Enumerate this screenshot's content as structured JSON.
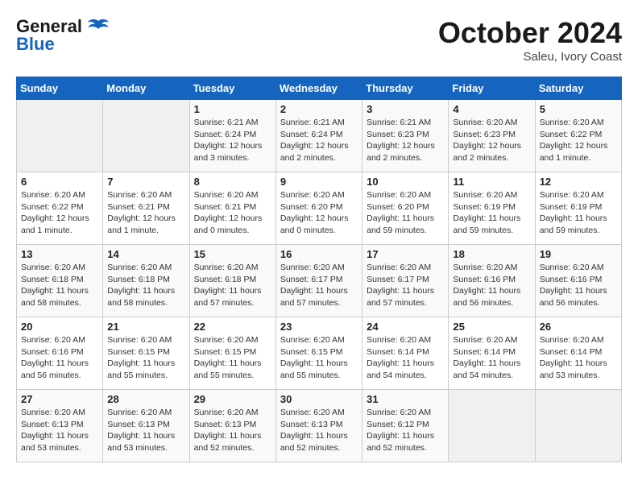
{
  "header": {
    "logo": {
      "general": "General",
      "blue": "Blue",
      "bird_unicode": "🐦"
    },
    "title": "October 2024",
    "subtitle": "Saleu, Ivory Coast"
  },
  "weekdays": [
    "Sunday",
    "Monday",
    "Tuesday",
    "Wednesday",
    "Thursday",
    "Friday",
    "Saturday"
  ],
  "weeks": [
    [
      {
        "day": "",
        "info": ""
      },
      {
        "day": "",
        "info": ""
      },
      {
        "day": "1",
        "info": "Sunrise: 6:21 AM\nSunset: 6:24 PM\nDaylight: 12 hours and 3 minutes."
      },
      {
        "day": "2",
        "info": "Sunrise: 6:21 AM\nSunset: 6:24 PM\nDaylight: 12 hours and 2 minutes."
      },
      {
        "day": "3",
        "info": "Sunrise: 6:21 AM\nSunset: 6:23 PM\nDaylight: 12 hours and 2 minutes."
      },
      {
        "day": "4",
        "info": "Sunrise: 6:20 AM\nSunset: 6:23 PM\nDaylight: 12 hours and 2 minutes."
      },
      {
        "day": "5",
        "info": "Sunrise: 6:20 AM\nSunset: 6:22 PM\nDaylight: 12 hours and 1 minute."
      }
    ],
    [
      {
        "day": "6",
        "info": "Sunrise: 6:20 AM\nSunset: 6:22 PM\nDaylight: 12 hours and 1 minute."
      },
      {
        "day": "7",
        "info": "Sunrise: 6:20 AM\nSunset: 6:21 PM\nDaylight: 12 hours and 1 minute."
      },
      {
        "day": "8",
        "info": "Sunrise: 6:20 AM\nSunset: 6:21 PM\nDaylight: 12 hours and 0 minutes."
      },
      {
        "day": "9",
        "info": "Sunrise: 6:20 AM\nSunset: 6:20 PM\nDaylight: 12 hours and 0 minutes."
      },
      {
        "day": "10",
        "info": "Sunrise: 6:20 AM\nSunset: 6:20 PM\nDaylight: 11 hours and 59 minutes."
      },
      {
        "day": "11",
        "info": "Sunrise: 6:20 AM\nSunset: 6:19 PM\nDaylight: 11 hours and 59 minutes."
      },
      {
        "day": "12",
        "info": "Sunrise: 6:20 AM\nSunset: 6:19 PM\nDaylight: 11 hours and 59 minutes."
      }
    ],
    [
      {
        "day": "13",
        "info": "Sunrise: 6:20 AM\nSunset: 6:18 PM\nDaylight: 11 hours and 58 minutes."
      },
      {
        "day": "14",
        "info": "Sunrise: 6:20 AM\nSunset: 6:18 PM\nDaylight: 11 hours and 58 minutes."
      },
      {
        "day": "15",
        "info": "Sunrise: 6:20 AM\nSunset: 6:18 PM\nDaylight: 11 hours and 57 minutes."
      },
      {
        "day": "16",
        "info": "Sunrise: 6:20 AM\nSunset: 6:17 PM\nDaylight: 11 hours and 57 minutes."
      },
      {
        "day": "17",
        "info": "Sunrise: 6:20 AM\nSunset: 6:17 PM\nDaylight: 11 hours and 57 minutes."
      },
      {
        "day": "18",
        "info": "Sunrise: 6:20 AM\nSunset: 6:16 PM\nDaylight: 11 hours and 56 minutes."
      },
      {
        "day": "19",
        "info": "Sunrise: 6:20 AM\nSunset: 6:16 PM\nDaylight: 11 hours and 56 minutes."
      }
    ],
    [
      {
        "day": "20",
        "info": "Sunrise: 6:20 AM\nSunset: 6:16 PM\nDaylight: 11 hours and 56 minutes."
      },
      {
        "day": "21",
        "info": "Sunrise: 6:20 AM\nSunset: 6:15 PM\nDaylight: 11 hours and 55 minutes."
      },
      {
        "day": "22",
        "info": "Sunrise: 6:20 AM\nSunset: 6:15 PM\nDaylight: 11 hours and 55 minutes."
      },
      {
        "day": "23",
        "info": "Sunrise: 6:20 AM\nSunset: 6:15 PM\nDaylight: 11 hours and 55 minutes."
      },
      {
        "day": "24",
        "info": "Sunrise: 6:20 AM\nSunset: 6:14 PM\nDaylight: 11 hours and 54 minutes."
      },
      {
        "day": "25",
        "info": "Sunrise: 6:20 AM\nSunset: 6:14 PM\nDaylight: 11 hours and 54 minutes."
      },
      {
        "day": "26",
        "info": "Sunrise: 6:20 AM\nSunset: 6:14 PM\nDaylight: 11 hours and 53 minutes."
      }
    ],
    [
      {
        "day": "27",
        "info": "Sunrise: 6:20 AM\nSunset: 6:13 PM\nDaylight: 11 hours and 53 minutes."
      },
      {
        "day": "28",
        "info": "Sunrise: 6:20 AM\nSunset: 6:13 PM\nDaylight: 11 hours and 53 minutes."
      },
      {
        "day": "29",
        "info": "Sunrise: 6:20 AM\nSunset: 6:13 PM\nDaylight: 11 hours and 52 minutes."
      },
      {
        "day": "30",
        "info": "Sunrise: 6:20 AM\nSunset: 6:13 PM\nDaylight: 11 hours and 52 minutes."
      },
      {
        "day": "31",
        "info": "Sunrise: 6:20 AM\nSunset: 6:12 PM\nDaylight: 11 hours and 52 minutes."
      },
      {
        "day": "",
        "info": ""
      },
      {
        "day": "",
        "info": ""
      }
    ]
  ]
}
